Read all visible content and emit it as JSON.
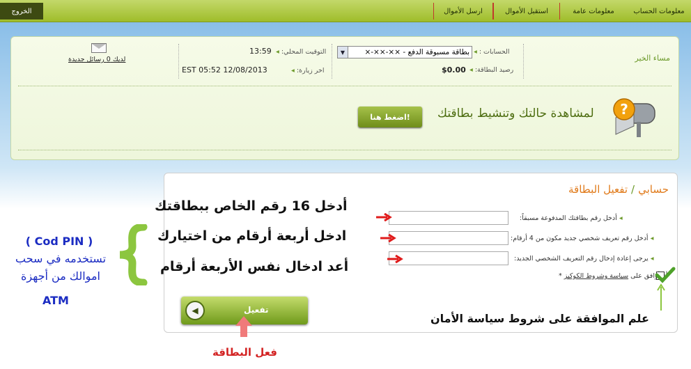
{
  "nav": {
    "logout": "الخروج",
    "items": [
      "معلومات الحساب",
      "معلومات عامة",
      "استقبل الأموال",
      "ارسل الأموال"
    ]
  },
  "account_panel": {
    "greeting": "مساء الخير",
    "accounts_label": "الحسابات :",
    "account_selected": "بطاقة مسبوقة الدفع - ××-××-×",
    "balance_label": "رصيد البطاقة:",
    "balance_value": "$0.00",
    "local_time_label": "التوقيت المحلي:",
    "local_time_value": "13:59",
    "last_visit_label": "اخر زيارة:",
    "last_visit_value": "EST 05:52 12/08/2013",
    "messages_text": "لديك 0 رسائل جديدة",
    "promo_text": "لمشاهدة حالتك وتنشيط بطاقتك",
    "press_here_button": "اضغط هنا!"
  },
  "activation": {
    "breadcrumb_root": "حسابي",
    "breadcrumb_current": "تفعيل البطاقة",
    "card_number_label": "أدخل رقم بطاقتك المدفوعة مسبقاً:",
    "pin_label": "أدخل رقم تعريف شخصي جديد مكون من 4 أرقام:",
    "pin_confirm_label": "يرجى إعادة إدخال رقم التعريف الشخصي الجديد:",
    "card_number_value": "",
    "pin_value": "",
    "pin_confirm_value": "",
    "agree_prefix": "أنا أوافق على",
    "agree_link": "سياسة وشروط الكوكيز",
    "agree_suffix": "*",
    "activate_button": "تفعيل"
  },
  "annotations": {
    "step1": "أدخل 16 رقم الخاص ببطاقتك",
    "step2": "ادخل أربعة أرقام من اختيارك",
    "step3": "أعد ادخال نفس الأربعة أرقام",
    "pin_title": "( Cod PIN )",
    "pin_desc_1": "تستخدمه في سحب",
    "pin_desc_2": "اموالك من أجهزة",
    "pin_desc_3": "ATM",
    "agree_note": "علم الموافقة على شروط سياسة الأمان",
    "activate_note": "فعل البطاقة"
  },
  "colors": {
    "nav_green": "#9fbd2a",
    "brand_green": "#6c9a2a",
    "orange": "#e07a1a",
    "annotation_blue": "#1b2cc2",
    "annotation_red": "#d32323"
  }
}
